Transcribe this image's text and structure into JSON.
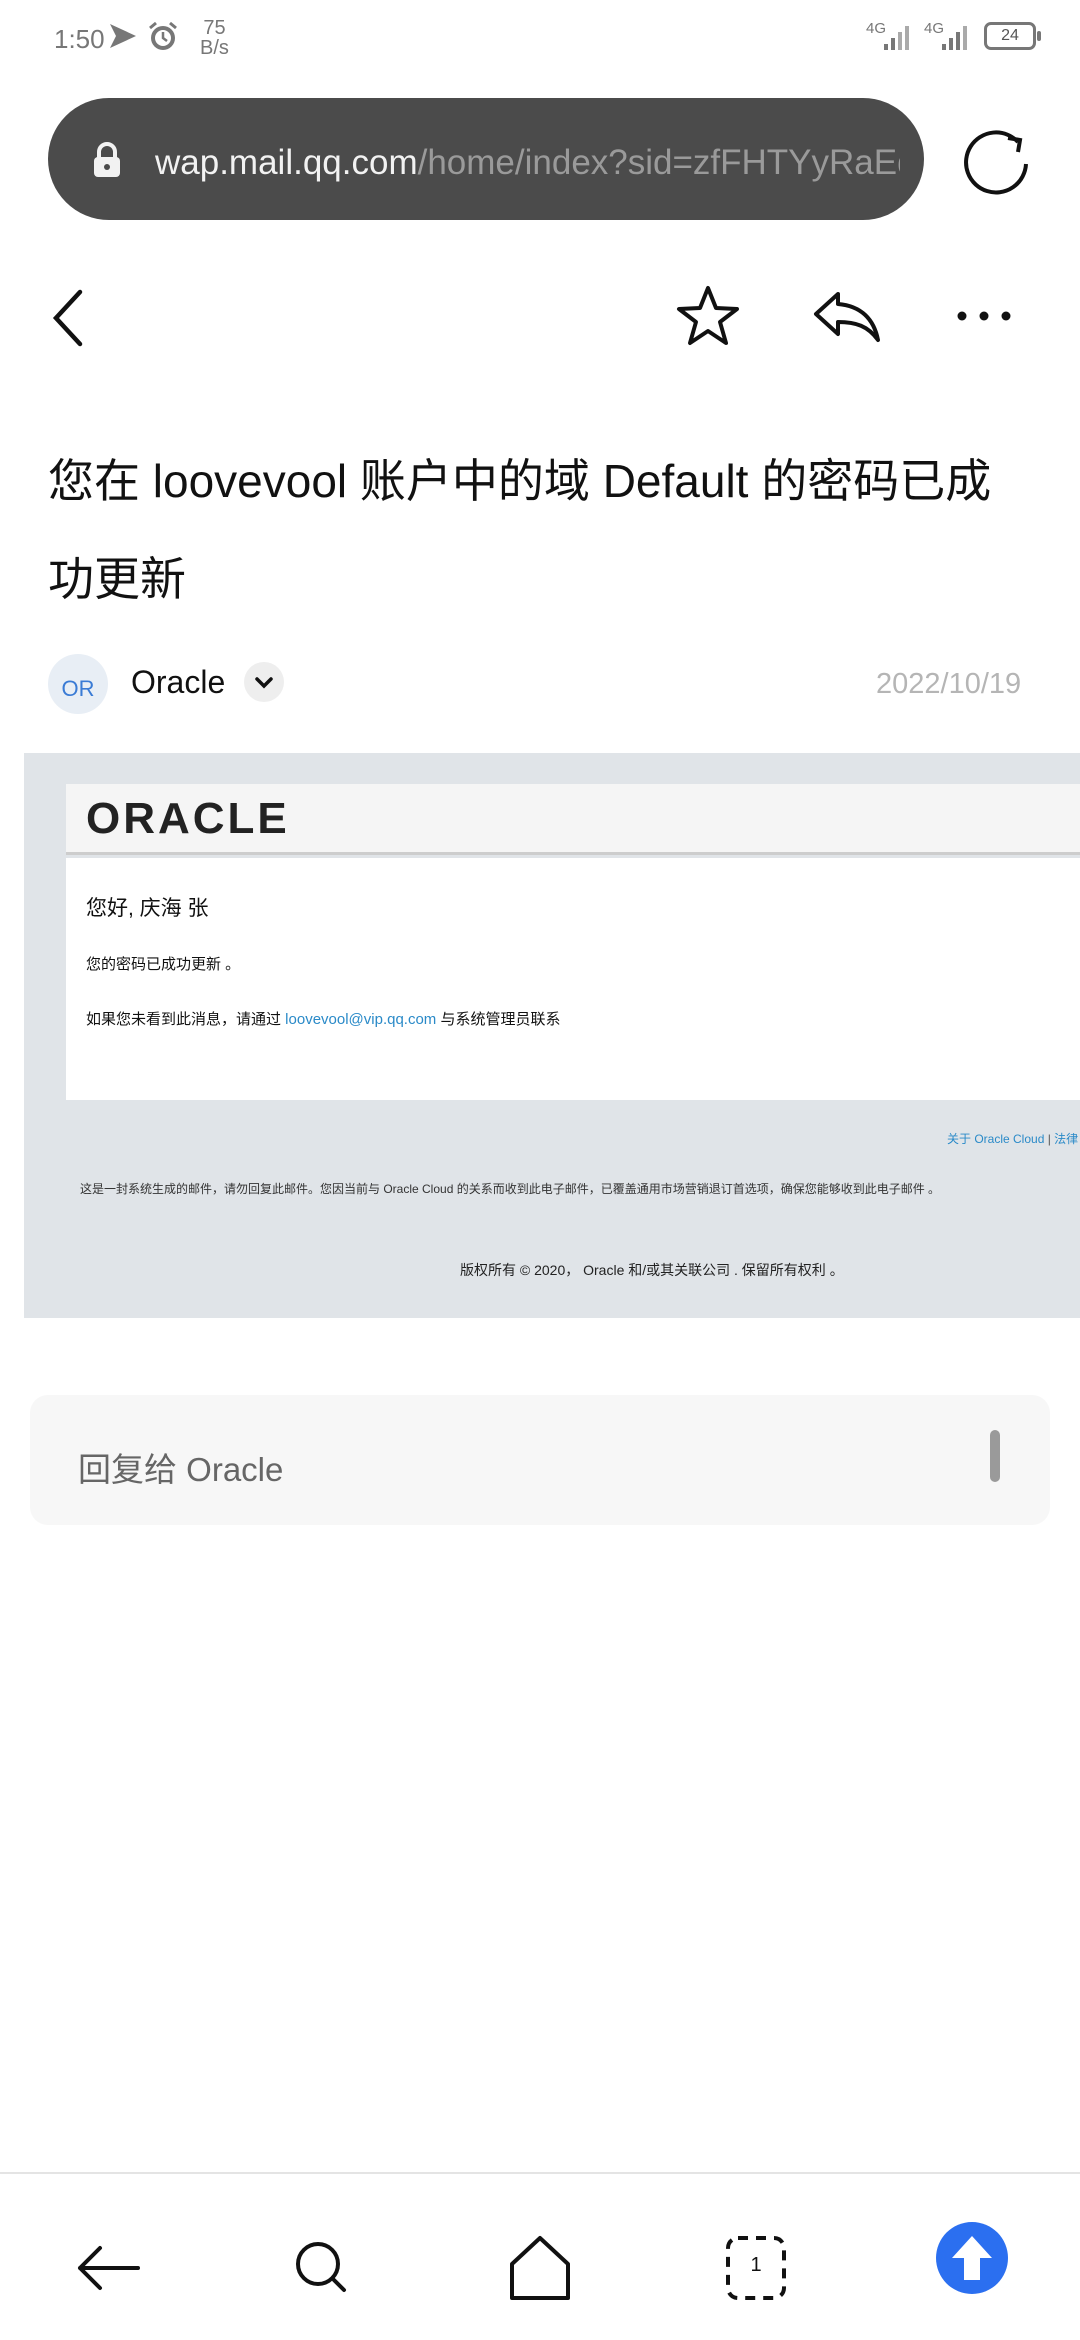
{
  "status_bar": {
    "time": "1:50",
    "speed_value": "75",
    "speed_unit": "B/s",
    "network_1": "4G",
    "network_2": "4G",
    "battery": "24"
  },
  "browser": {
    "url_host": "wap.mail.qq.com",
    "url_path": "/home/index?sid=zfFHTYyRaEq"
  },
  "email": {
    "subject": "您在 loovevool 账户中的域 Default 的密码已成功更新",
    "sender_initials": "OR",
    "sender_name": "Oracle",
    "date": "2022/10/19",
    "logo_text": "ORACLE",
    "greeting": "您好, 庆海 张",
    "line1": "您的密码已成功更新 。",
    "line2_prefix": "如果您未看到此消息，请通过 ",
    "line2_link": "loovevool@vip.qq.com",
    "line2_suffix": " 与系统管理员联系",
    "footer_link_1": "关于 Oracle Cloud",
    "footer_sep": " | ",
    "footer_link_2": "法律",
    "footer_note": "这是一封系统生成的邮件，请勿回复此邮件。您因当前与 Oracle Cloud 的关系而收到此电子邮件，已覆盖通用市场营销退订首选项，确保您能够收到此电子邮件 。",
    "copyright": "版权所有 © 2020， Oracle 和/或其关联公司 . 保留所有权利 。"
  },
  "reply": {
    "placeholder": "回复给 Oracle"
  },
  "nav": {
    "tab_count": "1"
  },
  "colors": {
    "accent": "#2b6ff0",
    "link": "#2a8ac8",
    "url_bar": "#4b4b4b"
  }
}
